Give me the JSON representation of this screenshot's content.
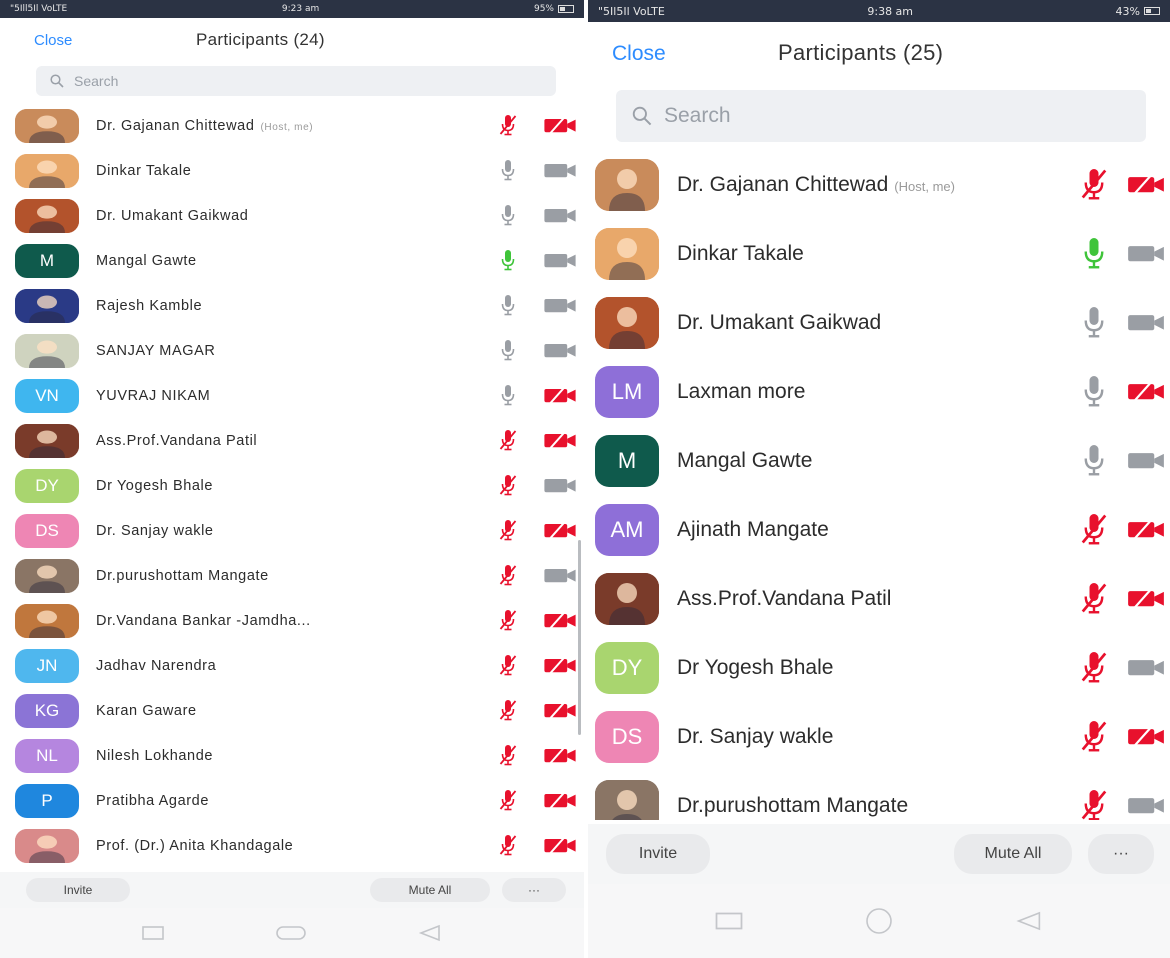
{
  "colors": {
    "accent": "#2d8cff",
    "muted_red": "#e8112d",
    "neutral_icon": "#9a9ea4",
    "speaking_green": "#3fc43a",
    "status_bar": "#2b3344"
  },
  "panels": [
    {
      "status": {
        "carrier": "\"5Ill5Il VoLTE",
        "time": "9:23 am",
        "battery": "95%"
      },
      "close_label": "Close",
      "title": "Participants (24)",
      "search_placeholder": "Search",
      "participants": [
        {
          "name": "Dr. Gajanan Chittewad",
          "tag": "(Host, me)",
          "avatar": {
            "type": "photo",
            "bg": "#c98b5b"
          },
          "mic": "muted",
          "cam": "off"
        },
        {
          "name": "Dinkar Takale",
          "avatar": {
            "type": "photo",
            "bg": "#e8a86a"
          },
          "mic": "on",
          "cam": "on"
        },
        {
          "name": "Dr. Umakant Gaikwad",
          "avatar": {
            "type": "photo",
            "bg": "#b3532c"
          },
          "mic": "on",
          "cam": "on"
        },
        {
          "name": "Mangal Gawte",
          "avatar": {
            "type": "initials",
            "initials": "M",
            "bg": "#0f5a4c"
          },
          "mic": "speaking",
          "cam": "on"
        },
        {
          "name": "Rajesh Kamble",
          "avatar": {
            "type": "photo",
            "bg": "#2a3a86"
          },
          "mic": "on",
          "cam": "on"
        },
        {
          "name": "SANJAY MAGAR",
          "avatar": {
            "type": "photo",
            "bg": "#cfd3bf"
          },
          "mic": "on",
          "cam": "on"
        },
        {
          "name": "YUVRAJ NIKAM",
          "avatar": {
            "type": "initials",
            "initials": "VN",
            "bg": "#3fb6ef"
          },
          "mic": "on",
          "cam": "off"
        },
        {
          "name": "Ass.Prof.Vandana Patil",
          "avatar": {
            "type": "photo",
            "bg": "#7a3b2a"
          },
          "mic": "muted",
          "cam": "off"
        },
        {
          "name": "Dr Yogesh Bhale",
          "avatar": {
            "type": "initials",
            "initials": "DY",
            "bg": "#a9d56f"
          },
          "mic": "muted",
          "cam": "on"
        },
        {
          "name": "Dr. Sanjay wakle",
          "avatar": {
            "type": "initials",
            "initials": "DS",
            "bg": "#ee86b4"
          },
          "mic": "muted",
          "cam": "off"
        },
        {
          "name": "Dr.purushottam Mangate",
          "avatar": {
            "type": "photo",
            "bg": "#8a7565"
          },
          "mic": "muted",
          "cam": "on"
        },
        {
          "name": "Dr.Vandana Bankar -Jamdha...",
          "avatar": {
            "type": "photo",
            "bg": "#c0773d"
          },
          "mic": "muted",
          "cam": "off"
        },
        {
          "name": "Jadhav Narendra",
          "avatar": {
            "type": "initials",
            "initials": "JN",
            "bg": "#4fb7ee"
          },
          "mic": "muted",
          "cam": "off"
        },
        {
          "name": "Karan Gaware",
          "avatar": {
            "type": "initials",
            "initials": "KG",
            "bg": "#8b74d6"
          },
          "mic": "muted",
          "cam": "off"
        },
        {
          "name": "Nilesh Lokhande",
          "avatar": {
            "type": "initials",
            "initials": "NL",
            "bg": "#b586df"
          },
          "mic": "muted",
          "cam": "off"
        },
        {
          "name": "Pratibha Agarde",
          "avatar": {
            "type": "initials",
            "initials": "P",
            "bg": "#1f87de"
          },
          "mic": "muted",
          "cam": "off"
        },
        {
          "name": "Prof. (Dr.) Anita Khandagale",
          "avatar": {
            "type": "photo",
            "bg": "#d98a8a"
          },
          "mic": "muted",
          "cam": "off"
        }
      ],
      "invite_label": "Invite",
      "mute_all_label": "Mute All",
      "more_label": "···"
    },
    {
      "status": {
        "carrier": "\"5Il5Il VoLTE",
        "time": "9:38 am",
        "battery": "43%"
      },
      "close_label": "Close",
      "title": "Participants (25)",
      "search_placeholder": "Search",
      "participants": [
        {
          "name": "Dr. Gajanan Chittewad",
          "tag": "(Host, me)",
          "avatar": {
            "type": "photo",
            "bg": "#c98b5b"
          },
          "mic": "muted",
          "cam": "off"
        },
        {
          "name": "Dinkar Takale",
          "avatar": {
            "type": "photo",
            "bg": "#e8a86a"
          },
          "mic": "speaking",
          "cam": "on"
        },
        {
          "name": "Dr. Umakant Gaikwad",
          "avatar": {
            "type": "photo",
            "bg": "#b3532c"
          },
          "mic": "on",
          "cam": "on"
        },
        {
          "name": "Laxman more",
          "avatar": {
            "type": "initials",
            "initials": "LM",
            "bg": "#8e6fd8"
          },
          "mic": "on",
          "cam": "off"
        },
        {
          "name": "Mangal Gawte",
          "avatar": {
            "type": "initials",
            "initials": "M",
            "bg": "#0f5a4c"
          },
          "mic": "on",
          "cam": "on"
        },
        {
          "name": "Ajinath Mangate",
          "avatar": {
            "type": "initials",
            "initials": "AM",
            "bg": "#8e6fd8"
          },
          "mic": "muted",
          "cam": "off"
        },
        {
          "name": "Ass.Prof.Vandana Patil",
          "avatar": {
            "type": "photo",
            "bg": "#7a3b2a"
          },
          "mic": "muted",
          "cam": "off"
        },
        {
          "name": "Dr Yogesh Bhale",
          "avatar": {
            "type": "initials",
            "initials": "DY",
            "bg": "#a9d56f"
          },
          "mic": "muted",
          "cam": "on"
        },
        {
          "name": "Dr. Sanjay wakle",
          "avatar": {
            "type": "initials",
            "initials": "DS",
            "bg": "#ee86b4"
          },
          "mic": "muted",
          "cam": "off"
        },
        {
          "name": "Dr.purushottam Mangate",
          "avatar": {
            "type": "photo",
            "bg": "#8a7565"
          },
          "mic": "muted",
          "cam": "on"
        }
      ],
      "invite_label": "Invite",
      "mute_all_label": "Mute All",
      "more_label": "···"
    }
  ]
}
